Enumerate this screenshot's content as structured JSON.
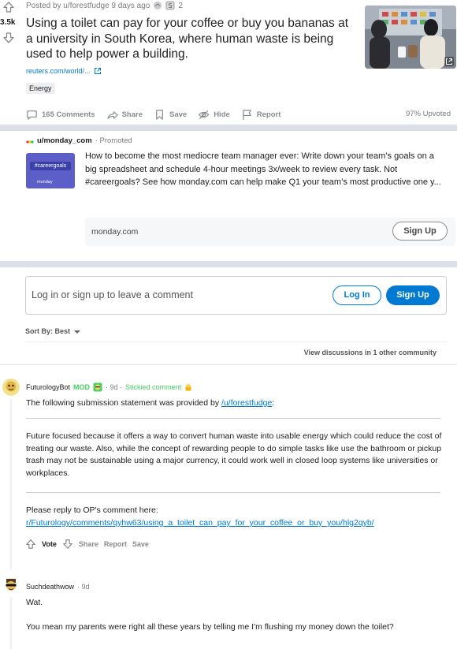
{
  "post": {
    "score": "3.5k",
    "meta_text": "Posted by u/forestfudge 9 days ago",
    "award_count": "2",
    "title": "Using a toilet can pay for your coffee or buy you bananas at a university in South Korea, where human waste is being used to help power a building.",
    "link_domain": "reuters.com/world/...",
    "flair": "Energy",
    "actions": {
      "comments": "165 Comments",
      "share": "Share",
      "save": "Save",
      "hide": "Hide",
      "report": "Report"
    },
    "upvoted": "97% Upvoted"
  },
  "promoted": {
    "user": "u/monday_com",
    "tag": "· Promoted",
    "image_hashtag": "#careergoals",
    "image_brand": "monday",
    "text": "How to become the most mediocre team manager ever: Write down your team’s goals on a big spreadsheet and schedule 4-hour meetings 3x/week to review every task. Not #careergoals? See how monday.com can help make Q1 your team’s most productive one y...",
    "domain": "monday.com",
    "cta": "Sign Up"
  },
  "comment_box": {
    "prompt": "Log in or sign up to leave a comment",
    "login": "Log In",
    "signup": "Sign Up"
  },
  "sort": {
    "label": "Sort By: Best"
  },
  "view_discussions": "View discussions in 1 other community",
  "comments": [
    {
      "author": "FuturologyBot",
      "mod": "MOD",
      "time": "· 9d ·",
      "stickied": "Stickied comment",
      "intro": "The following submission statement was provided by",
      "intro_link": "/u/forestfudge",
      "intro_end": ":",
      "paragraph": "Future focused because it offers a way to convert human waste into usable energy which could reduce the cost of treating our waste. Also, while the concept of rewarding people to do simple tasks like use the bathroom or pickup trash may not be sustainable using a major currency, it could work well in closed loop systems like universities or workplaces.",
      "reply_prompt": "Please reply to OP's comment here:",
      "reply_link": "r/Futurology/comments/qyhw63/using_a_toilet_can_pay_for_your_coffee_or_buy_you/hlg2qyb/",
      "actions": {
        "vote": "Vote",
        "share": "Share",
        "report": "Report",
        "save": "Save"
      }
    },
    {
      "author": "Suchdeathwow",
      "time": "· 9d",
      "line1": "Wat.",
      "line2": "You mean my parents were right all these years by telling me I'm flushing my money down the toilet?"
    }
  ],
  "colors": {
    "accent_blue": "#0079d3",
    "mod_green": "#46d160",
    "band_gray": "#dae0e6",
    "muted_text": "#787c7e"
  }
}
